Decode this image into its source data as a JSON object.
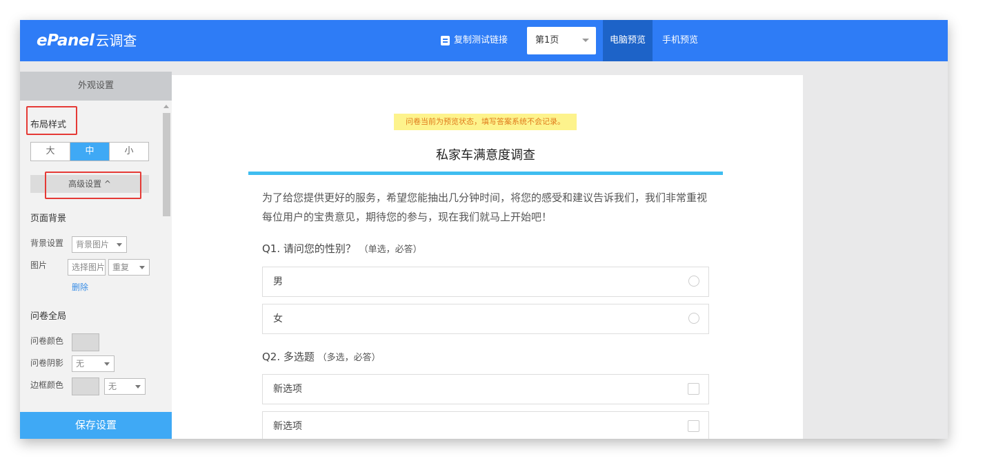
{
  "topbar": {
    "logo_brand": "ePanel",
    "logo_sub": "云调查",
    "copy_link_label": "复制测试链接",
    "page_select_value": "第1页",
    "tabs": [
      {
        "label": "电脑预览",
        "active": true
      },
      {
        "label": "手机预览",
        "active": false
      }
    ],
    "accent_color": "#2e7cf6"
  },
  "sidebar": {
    "header": "外观设置",
    "layout_style_label": "布局样式",
    "size_options": [
      {
        "label": "大",
        "active": false
      },
      {
        "label": "中",
        "active": true
      },
      {
        "label": "小",
        "active": false
      }
    ],
    "advanced_label": "高级设置 ^",
    "page_bg_section": "页面背景",
    "bg_setting_label": "背景设置",
    "bg_setting_value": "背景图片",
    "image_label": "图片",
    "choose_image_label": "选择图片",
    "repeat_value": "重复",
    "delete_label": "删除",
    "global_section": "问卷全局",
    "survey_color_label": "问卷颜色",
    "survey_shadow_label": "问卷阴影",
    "shadow_value": "无",
    "border_color_label": "边框颜色",
    "border_value": "无",
    "save_label": "保存设置"
  },
  "survey": {
    "notice": "问卷当前为预览状态，填写答案系统不会记录。",
    "title": "私家车满意度调查",
    "intro": "为了给您提供更好的服务，希望您能抽出几分钟时间，将您的感受和建议告诉我们，我们非常重视每位用户的宝贵意见，期待您的参与，现在我们就马上开始吧！",
    "questions": [
      {
        "label": "Q1. 请问您的性别？",
        "hint": "（单选，必答）",
        "options": [
          "男",
          "女"
        ]
      },
      {
        "label": "Q2. 多选题",
        "hint": "（多选，必答）",
        "options": [
          "新选项",
          "新选项"
        ]
      }
    ]
  }
}
